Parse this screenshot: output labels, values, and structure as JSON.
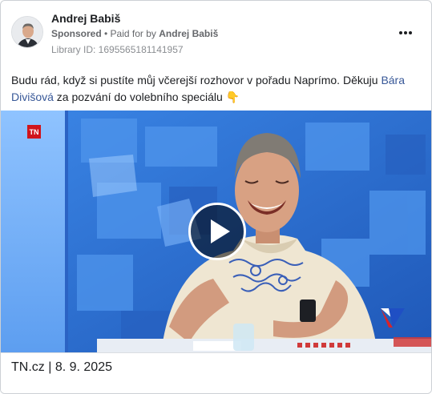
{
  "post": {
    "author": "Andrej Babiš",
    "sponsored_label": "Sponsored",
    "separator": " • ",
    "paid_for_prefix": "Paid for by ",
    "paid_for_name": "Andrej Babiš",
    "library_id": "Library ID: 1695565181141957",
    "text_part1": "Budu rád, když si pustíte můj včerejší rozhovor v pořadu Naprímo. Děkuju ",
    "mention": "Bára Divišová",
    "text_part2": " za pozvání do volebního speciálu ",
    "emoji": "👇"
  },
  "video": {
    "channel_badge": "TN",
    "caption": "TN.cz | 8. 9. 2025"
  },
  "icons": {
    "more": "more-horizontal-icon",
    "play": "play-icon",
    "avatar": "avatar"
  },
  "colors": {
    "studio_blue": "#2f6fd0",
    "link": "#385898",
    "tn_red": "#d0141b"
  }
}
